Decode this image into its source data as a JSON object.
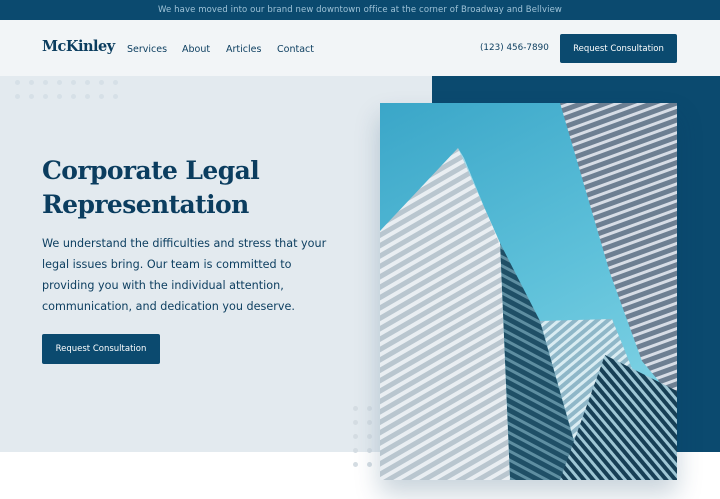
{
  "announcement": "We have moved into our brand new downtown office at the corner of Broadway and Bellview",
  "nav": {
    "logo": "McKinley",
    "links": [
      "Services",
      "About",
      "Articles",
      "Contact"
    ],
    "phone": "(123) 456-7890",
    "cta": "Request Consultation"
  },
  "hero": {
    "title_line1": "Corporate Legal",
    "title_line2": "Representation",
    "description": "We understand the difficulties and stress that your legal issues bring. Our team is committed to providing you with the individual attention, communication, and dedication you deserve.",
    "cta": "Request Consultation",
    "image": "skyscraper-photo"
  },
  "colors": {
    "brand": "#0b4a6f",
    "text": "#0b3d5f",
    "hero_background": "#e3eaef",
    "nav_background": "#f2f5f7"
  }
}
